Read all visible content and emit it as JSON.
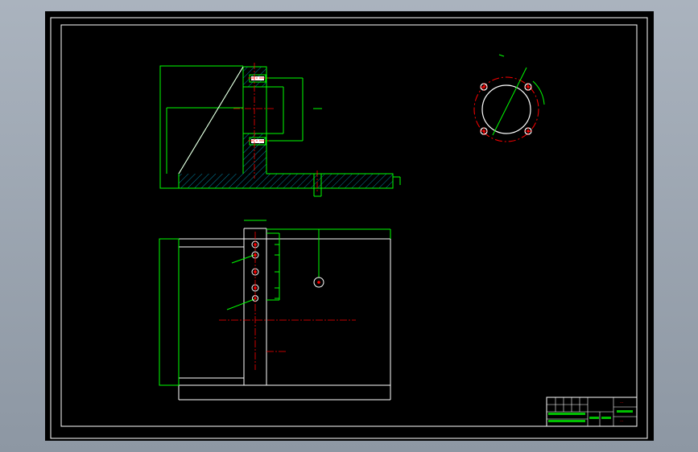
{
  "drawing": {
    "colors": {
      "background": "#000000",
      "border": "#ffffff",
      "outline": "#00ff00",
      "centerline": "#ff0000",
      "hatch": "#00a0c8",
      "annotation": "#ff00ff"
    }
  },
  "title_block": {
    "title_red": "---",
    "drawing_no": "---"
  }
}
